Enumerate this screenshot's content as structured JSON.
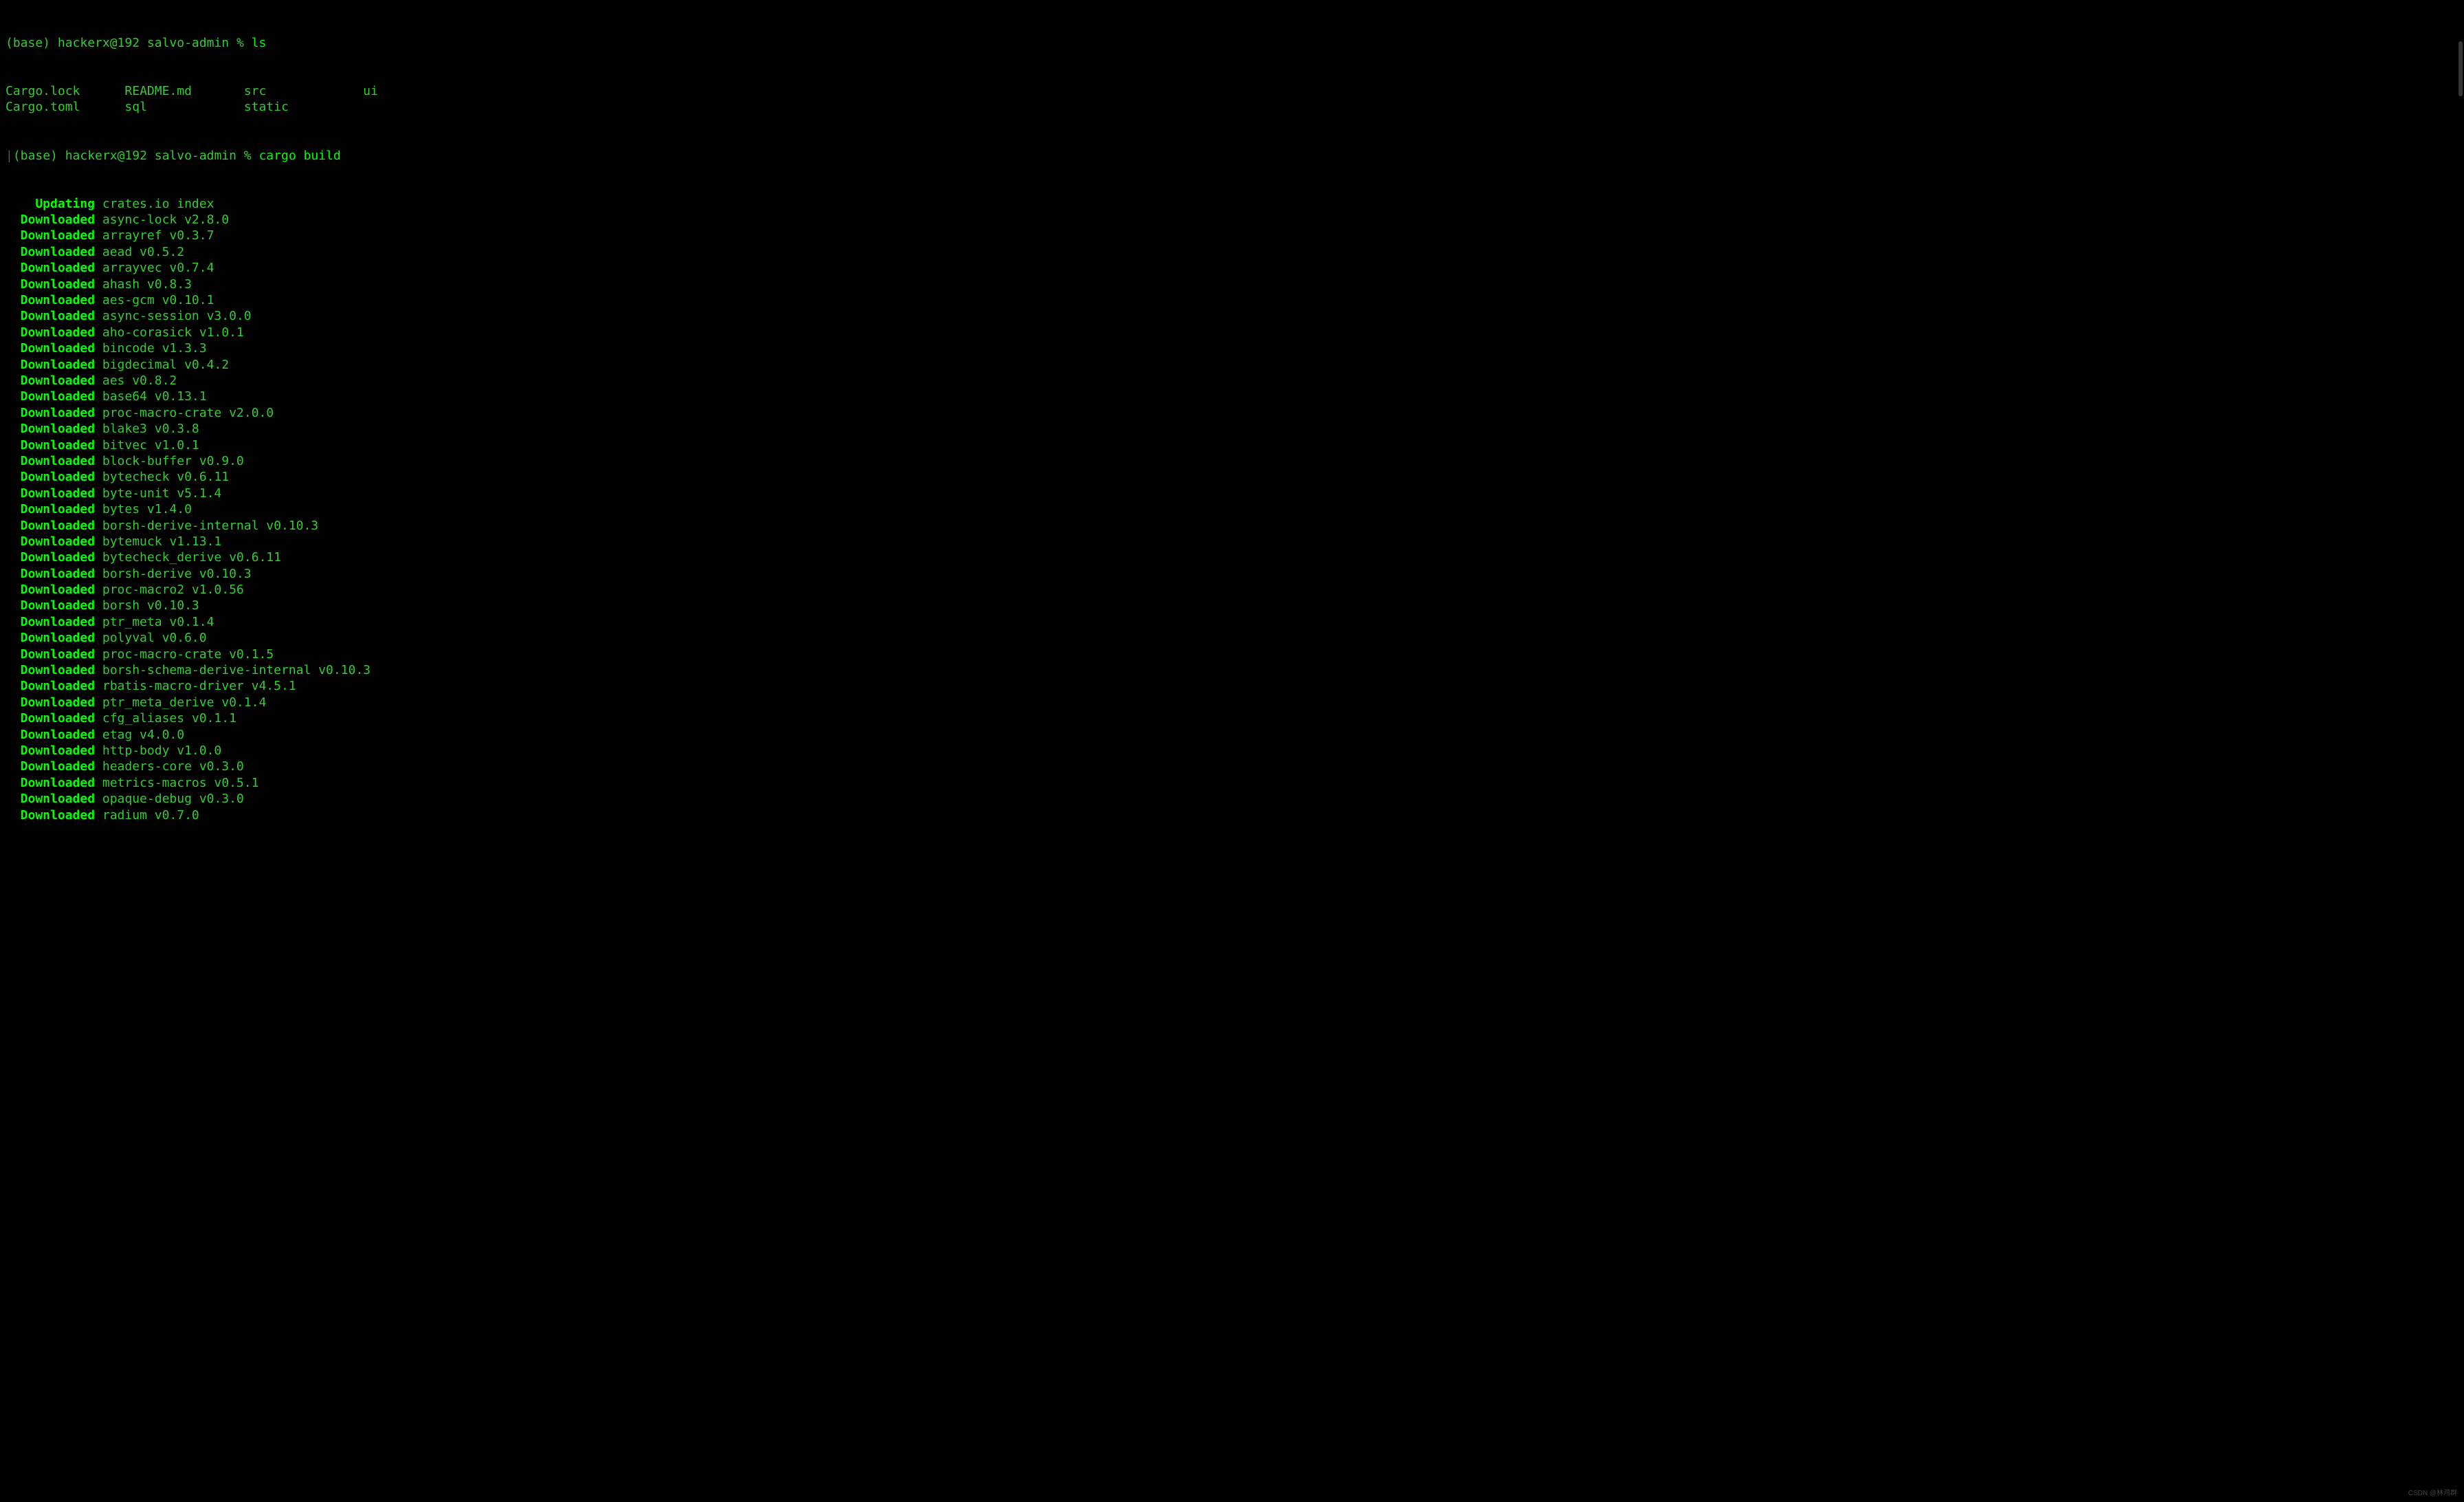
{
  "prompt1": {
    "prefix": "(base) hackerx@192 salvo-admin % ",
    "command": "ls"
  },
  "ls_output": [
    [
      "Cargo.lock",
      "README.md",
      "src",
      "ui"
    ],
    [
      "Cargo.toml",
      "sql",
      "static",
      ""
    ]
  ],
  "prompt2": {
    "pipe": "|",
    "prefix": "(base) hackerx@192 salvo-admin % ",
    "command": "cargo build"
  },
  "cargo_output": [
    {
      "status": "Updating",
      "text": "crates.io index"
    },
    {
      "status": "Downloaded",
      "text": "async-lock v2.8.0"
    },
    {
      "status": "Downloaded",
      "text": "arrayref v0.3.7"
    },
    {
      "status": "Downloaded",
      "text": "aead v0.5.2"
    },
    {
      "status": "Downloaded",
      "text": "arrayvec v0.7.4"
    },
    {
      "status": "Downloaded",
      "text": "ahash v0.8.3"
    },
    {
      "status": "Downloaded",
      "text": "aes-gcm v0.10.1"
    },
    {
      "status": "Downloaded",
      "text": "async-session v3.0.0"
    },
    {
      "status": "Downloaded",
      "text": "aho-corasick v1.0.1"
    },
    {
      "status": "Downloaded",
      "text": "bincode v1.3.3"
    },
    {
      "status": "Downloaded",
      "text": "bigdecimal v0.4.2"
    },
    {
      "status": "Downloaded",
      "text": "aes v0.8.2"
    },
    {
      "status": "Downloaded",
      "text": "base64 v0.13.1"
    },
    {
      "status": "Downloaded",
      "text": "proc-macro-crate v2.0.0"
    },
    {
      "status": "Downloaded",
      "text": "blake3 v0.3.8"
    },
    {
      "status": "Downloaded",
      "text": "bitvec v1.0.1"
    },
    {
      "status": "Downloaded",
      "text": "block-buffer v0.9.0"
    },
    {
      "status": "Downloaded",
      "text": "bytecheck v0.6.11"
    },
    {
      "status": "Downloaded",
      "text": "byte-unit v5.1.4"
    },
    {
      "status": "Downloaded",
      "text": "bytes v1.4.0"
    },
    {
      "status": "Downloaded",
      "text": "borsh-derive-internal v0.10.3"
    },
    {
      "status": "Downloaded",
      "text": "bytemuck v1.13.1"
    },
    {
      "status": "Downloaded",
      "text": "bytecheck_derive v0.6.11"
    },
    {
      "status": "Downloaded",
      "text": "borsh-derive v0.10.3"
    },
    {
      "status": "Downloaded",
      "text": "proc-macro2 v1.0.56"
    },
    {
      "status": "Downloaded",
      "text": "borsh v0.10.3"
    },
    {
      "status": "Downloaded",
      "text": "ptr_meta v0.1.4"
    },
    {
      "status": "Downloaded",
      "text": "polyval v0.6.0"
    },
    {
      "status": "Downloaded",
      "text": "proc-macro-crate v0.1.5"
    },
    {
      "status": "Downloaded",
      "text": "borsh-schema-derive-internal v0.10.3"
    },
    {
      "status": "Downloaded",
      "text": "rbatis-macro-driver v4.5.1"
    },
    {
      "status": "Downloaded",
      "text": "ptr_meta_derive v0.1.4"
    },
    {
      "status": "Downloaded",
      "text": "cfg_aliases v0.1.1"
    },
    {
      "status": "Downloaded",
      "text": "etag v4.0.0"
    },
    {
      "status": "Downloaded",
      "text": "http-body v1.0.0"
    },
    {
      "status": "Downloaded",
      "text": "headers-core v0.3.0"
    },
    {
      "status": "Downloaded",
      "text": "metrics-macros v0.5.1"
    },
    {
      "status": "Downloaded",
      "text": "opaque-debug v0.3.0"
    },
    {
      "status": "Downloaded",
      "text": "radium v0.7.0"
    }
  ],
  "watermark": "CSDN @林鸿群"
}
